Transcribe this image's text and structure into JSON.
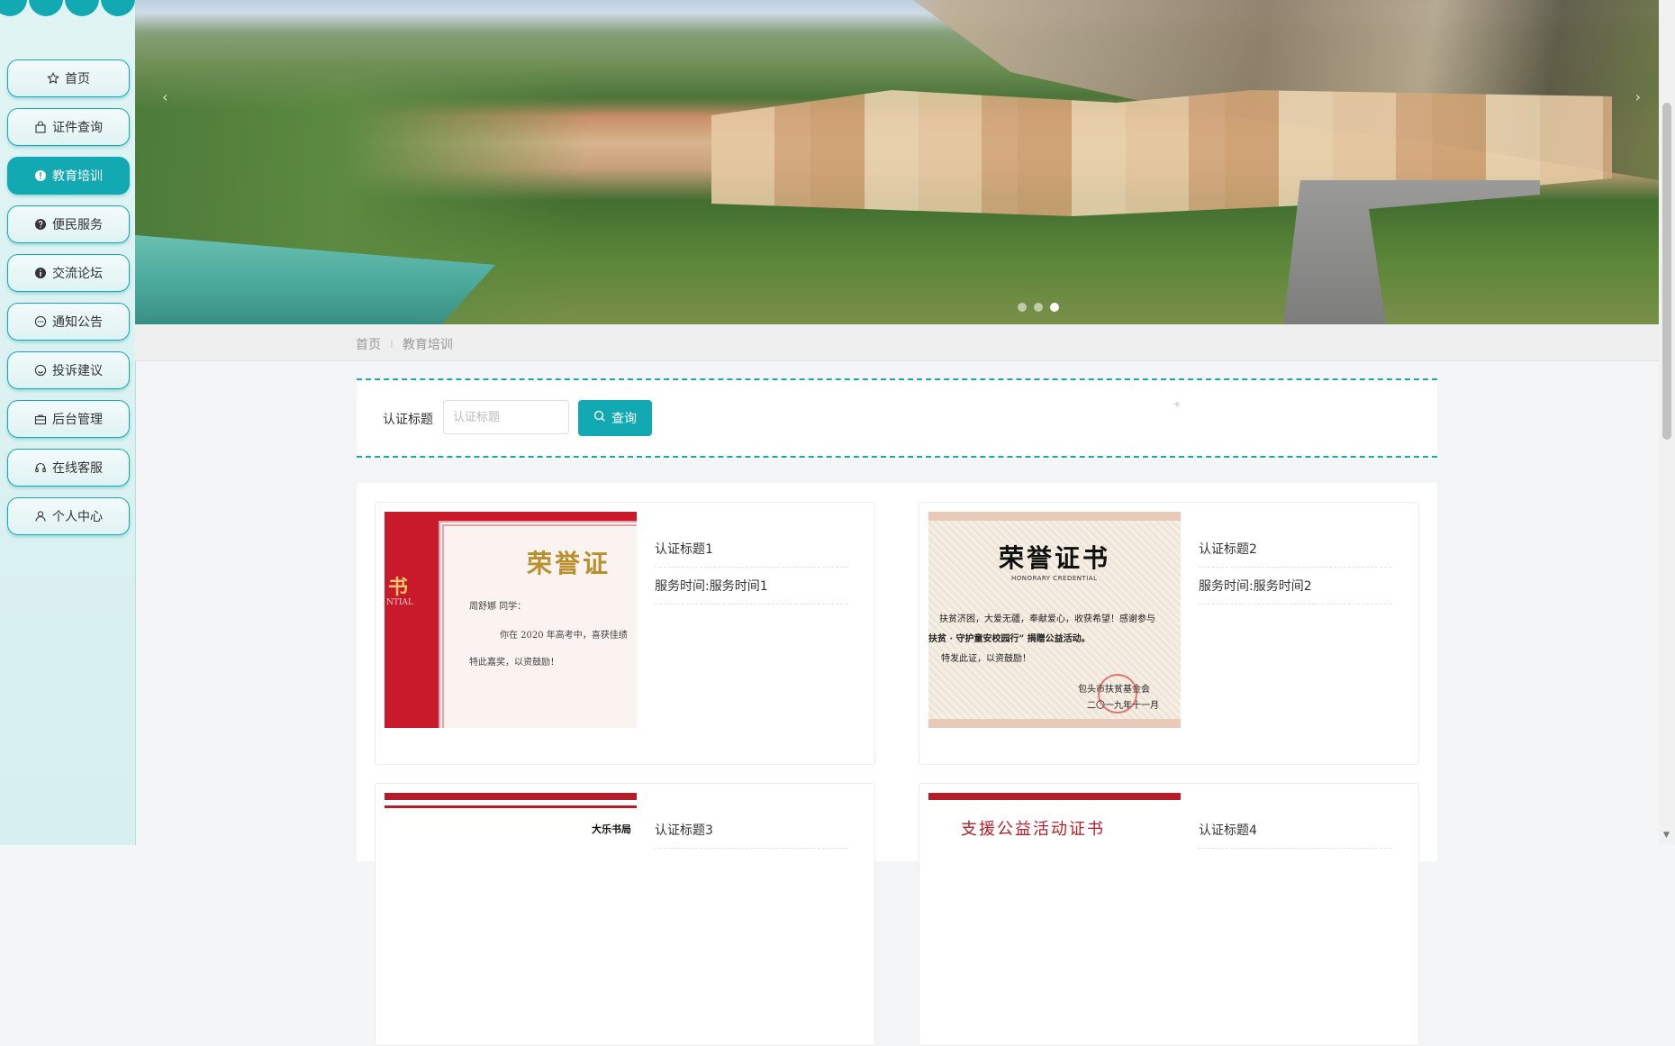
{
  "colors": {
    "accent": "#12a9b3",
    "sidebar_bg": "#e0f4f4"
  },
  "sidebar": {
    "items": [
      {
        "label": "首页",
        "icon": "star-icon",
        "active": false
      },
      {
        "label": "证件查询",
        "icon": "bag-icon",
        "active": false
      },
      {
        "label": "教育培训",
        "icon": "info-circle-icon",
        "active": true
      },
      {
        "label": "便民服务",
        "icon": "question-circle-icon",
        "active": false
      },
      {
        "label": "交流论坛",
        "icon": "info-circle-icon",
        "active": false
      },
      {
        "label": "通知公告",
        "icon": "chat-icon",
        "active": false
      },
      {
        "label": "投诉建议",
        "icon": "smile-icon",
        "active": false
      },
      {
        "label": "后台管理",
        "icon": "briefcase-icon",
        "active": false
      },
      {
        "label": "在线客服",
        "icon": "headset-icon",
        "active": false
      },
      {
        "label": "个人中心",
        "icon": "user-icon",
        "active": false
      }
    ]
  },
  "carousel": {
    "slides": 3,
    "active_index": 2
  },
  "breadcrumb": {
    "home": "首页",
    "separator": "⁝",
    "current": "教育培训"
  },
  "search": {
    "label": "认证标题",
    "placeholder": "认证标题",
    "button_label": "查询"
  },
  "cards": [
    {
      "title": "认证标题1",
      "time": "服务时间:服务时间1",
      "image": {
        "type": "certificate",
        "heading": "荣誉证",
        "side_word": "书",
        "side_en": "NTIAL",
        "name_line": "周舒娜 同学：",
        "body": "你在 2020 年高考中，喜获佳绩",
        "closing": "特此嘉奖，以资鼓励！"
      }
    },
    {
      "title": "认证标题2",
      "time": "服务时间:服务时间2",
      "image": {
        "type": "certificate",
        "heading": "荣誉证书",
        "sub": "HONORARY CREDENTIAL",
        "line1": "扶贫济困，大爱无疆，奉献爱心，收获希望！感谢参与",
        "line2": "扶贫 · 守护童安校园行” 捐赠公益活动。",
        "line3": "特发此证，以资鼓励！",
        "issuer": "包头市扶贫基金会",
        "date": "二〇一九年十一月"
      }
    },
    {
      "title": "认证标题3",
      "time": "",
      "image": {
        "type": "certificate",
        "brand": "大乐书局"
      }
    },
    {
      "title": "认证标题4",
      "time": "",
      "image": {
        "type": "certificate",
        "heading": "支援公益活动证书"
      }
    }
  ]
}
